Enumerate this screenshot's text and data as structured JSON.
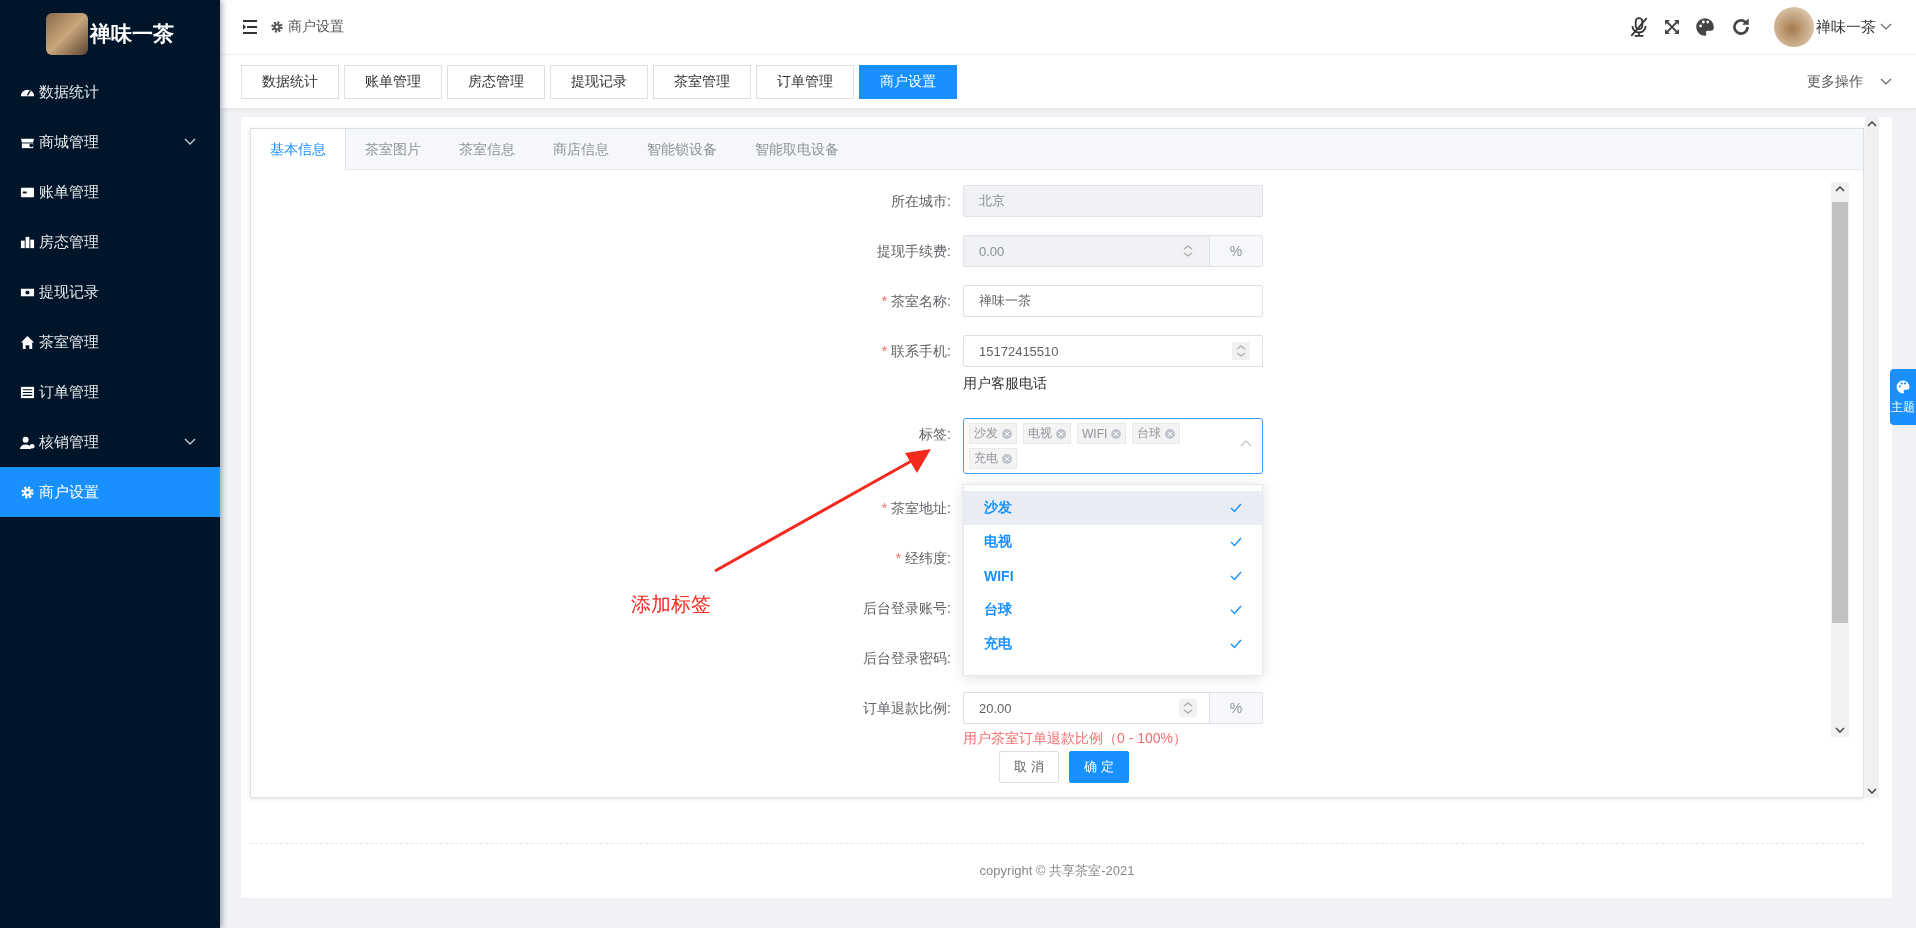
{
  "sidebar": {
    "brand": "禅味一茶",
    "items": [
      {
        "label": "数据统计",
        "submenu": false,
        "selected": false
      },
      {
        "label": "商城管理",
        "submenu": true,
        "selected": false
      },
      {
        "label": "账单管理",
        "submenu": false,
        "selected": false
      },
      {
        "label": "房态管理",
        "submenu": false,
        "selected": false
      },
      {
        "label": "提现记录",
        "submenu": false,
        "selected": false
      },
      {
        "label": "茶室管理",
        "submenu": false,
        "selected": false
      },
      {
        "label": "订单管理",
        "submenu": false,
        "selected": false
      },
      {
        "label": "核销管理",
        "submenu": true,
        "selected": false
      },
      {
        "label": "商户设置",
        "submenu": false,
        "selected": true
      }
    ]
  },
  "header": {
    "breadcrumb": "商户设置",
    "user": "禅味一茶"
  },
  "page_tabs": {
    "items": [
      {
        "label": "数据统计",
        "selected": false
      },
      {
        "label": "账单管理",
        "selected": false
      },
      {
        "label": "房态管理",
        "selected": false
      },
      {
        "label": "提现记录",
        "selected": false
      },
      {
        "label": "茶室管理",
        "selected": false
      },
      {
        "label": "订单管理",
        "selected": false
      },
      {
        "label": "商户设置",
        "selected": true
      }
    ],
    "more": "更多操作"
  },
  "form_tabs": [
    {
      "label": "基本信息",
      "selected": true
    },
    {
      "label": "茶室图片",
      "selected": false
    },
    {
      "label": "茶室信息",
      "selected": false
    },
    {
      "label": "商店信息",
      "selected": false
    },
    {
      "label": "智能锁设备",
      "selected": false
    },
    {
      "label": "智能取电设备",
      "selected": false
    }
  ],
  "form": {
    "required_mark": "*",
    "fields": [
      {
        "label": "所在城市:",
        "kind": "text",
        "required": false,
        "disabled": true,
        "value": "北京"
      },
      {
        "label": "提现手续费:",
        "kind": "number",
        "required": false,
        "disabled": true,
        "value": "0.00",
        "unit": "%"
      },
      {
        "label": "茶室名称:",
        "kind": "text",
        "required": true,
        "disabled": false,
        "value": "禅味一茶"
      },
      {
        "label": "联系手机:",
        "kind": "number",
        "required": true,
        "disabled": false,
        "value": "15172415510",
        "hint": {
          "text": "用户客服电话",
          "kind": "note"
        }
      },
      {
        "label": "标签:",
        "kind": "tags",
        "required": false,
        "expanded": true,
        "tags": [
          "沙发",
          "电视",
          "WIFI",
          "台球",
          "充电"
        ],
        "options": [
          {
            "label": "沙发",
            "selected": true,
            "hovered": true
          },
          {
            "label": "电视",
            "selected": true,
            "hovered": false
          },
          {
            "label": "WIFI",
            "selected": true,
            "hovered": false
          },
          {
            "label": "台球",
            "selected": true,
            "hovered": false
          },
          {
            "label": "充电",
            "selected": true,
            "hovered": false
          }
        ]
      },
      {
        "label": "茶室地址:",
        "kind": "text",
        "required": true
      },
      {
        "label": "经纬度:",
        "kind": "text",
        "required": true
      },
      {
        "label": "后台登录账号:",
        "kind": "text",
        "required": false
      },
      {
        "label": "后台登录密码:",
        "kind": "text",
        "required": false
      },
      {
        "label": "订单退款比例:",
        "kind": "number",
        "required": false,
        "disabled": false,
        "value": "20.00",
        "unit": "%",
        "hint": {
          "text": "用户茶室订单退款比例（0 - 100%）",
          "kind": "error"
        }
      }
    ],
    "buttons": [
      {
        "label": "取 消",
        "kind": "secondary"
      },
      {
        "label": "确 定",
        "kind": "primary"
      }
    ]
  },
  "annotation": {
    "text": "添加标签"
  },
  "footer": "copyright © 共享茶室-2021",
  "theme_tab": "主题"
}
